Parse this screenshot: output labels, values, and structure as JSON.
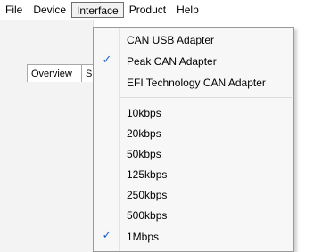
{
  "menubar": {
    "items": [
      {
        "label": "File"
      },
      {
        "label": "Device"
      },
      {
        "label": "Interface"
      },
      {
        "label": "Product"
      },
      {
        "label": "Help"
      }
    ]
  },
  "tabs": {
    "overview": "Overview",
    "partial": "S"
  },
  "interface_menu": {
    "adapters": [
      {
        "label": "CAN USB Adapter",
        "checked": false
      },
      {
        "label": "Peak CAN Adapter",
        "checked": true
      },
      {
        "label": "EFI Technology CAN Adapter",
        "checked": false
      }
    ],
    "bitrates": [
      {
        "label": "10kbps",
        "checked": false
      },
      {
        "label": "20kbps",
        "checked": false
      },
      {
        "label": "50kbps",
        "checked": false
      },
      {
        "label": "125kbps",
        "checked": false
      },
      {
        "label": "250kbps",
        "checked": false
      },
      {
        "label": "500kbps",
        "checked": false
      },
      {
        "label": "1Mbps",
        "checked": true
      }
    ],
    "check_glyph": "✓",
    "check_color": "#1a62c8"
  }
}
